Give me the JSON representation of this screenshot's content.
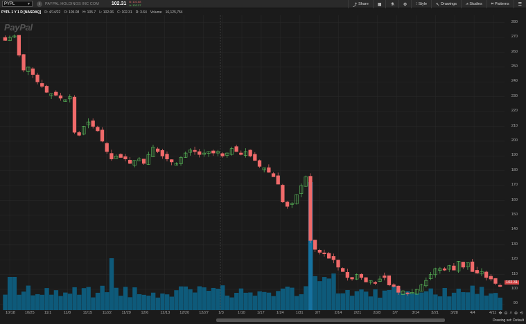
{
  "toolbar": {
    "symbol": "PYPL",
    "company": "PAYPAL HOLDINGS INC COM",
    "last": "102.31",
    "bid": "B: 102.68",
    "ask": "A: 102.37",
    "share": "Share",
    "style": "Style",
    "drawings": "Drawings",
    "studies": "Studies",
    "patterns": "Patterns"
  },
  "info": {
    "title": "PYPL 1 Y 1 D [NASDAQ]",
    "date": "D: 4/14/22",
    "open": "O: 105.08",
    "high": "H: 105.7",
    "low": "L: 102.06",
    "close": "C: 102.31",
    "range": "R: 3.64",
    "volume_label": "Volume",
    "volume": "16,125,754"
  },
  "logo": "PayPal",
  "price_tag": "102.31",
  "bottom": {
    "drawing_set": "Drawing set: Default"
  },
  "colors": {
    "up": "#5ec45e",
    "down": "#f06a6a",
    "volume": "#0e5a7a",
    "volume_hi": "#1672a0",
    "bg": "#1b1b1b",
    "grid": "#2a2a2a"
  },
  "chart_data": {
    "type": "candlestick",
    "title": "PYPL 1 Y 1 D [NASDAQ]",
    "y_ticks": [
      90,
      100,
      110,
      120,
      130,
      140,
      150,
      160,
      170,
      180,
      190,
      200,
      210,
      220,
      230,
      240,
      250,
      260,
      270,
      280
    ],
    "x_ticks": [
      "10/18",
      "10/25",
      "11/1",
      "11/8",
      "11/15",
      "11/22",
      "11/29",
      "12/6",
      "12/13",
      "12/20",
      "12/27",
      "1/3",
      "1/10",
      "1/17",
      "1/24",
      "1/31",
      "2/7",
      "2/14",
      "2/21",
      "2/28",
      "3/7",
      "3/14",
      "3/21",
      "3/28",
      "4/4",
      "4/11"
    ],
    "ylim": [
      86,
      285
    ],
    "closes": [
      268,
      270,
      271,
      258,
      248,
      250,
      245,
      240,
      237,
      233,
      232,
      231,
      229,
      228,
      230,
      206,
      204,
      210,
      213,
      210,
      207,
      200,
      193,
      188,
      190,
      189,
      188,
      185,
      187,
      188,
      185,
      191,
      196,
      193,
      190,
      188,
      186,
      185,
      189,
      192,
      194,
      193,
      191,
      192,
      193,
      192,
      193,
      190,
      192,
      195,
      193,
      191,
      193,
      190,
      187,
      183,
      182,
      179,
      176,
      171,
      159,
      156,
      158,
      164,
      170,
      176,
      133,
      127,
      125,
      124,
      121,
      120,
      115,
      112,
      108,
      107,
      110,
      108,
      105,
      106,
      104,
      107,
      108,
      103,
      102,
      98,
      99,
      97,
      98,
      100,
      103,
      106,
      110,
      114,
      114,
      113,
      116,
      113,
      119,
      115,
      118,
      112,
      111,
      112,
      108,
      107,
      104,
      102
    ]
  }
}
